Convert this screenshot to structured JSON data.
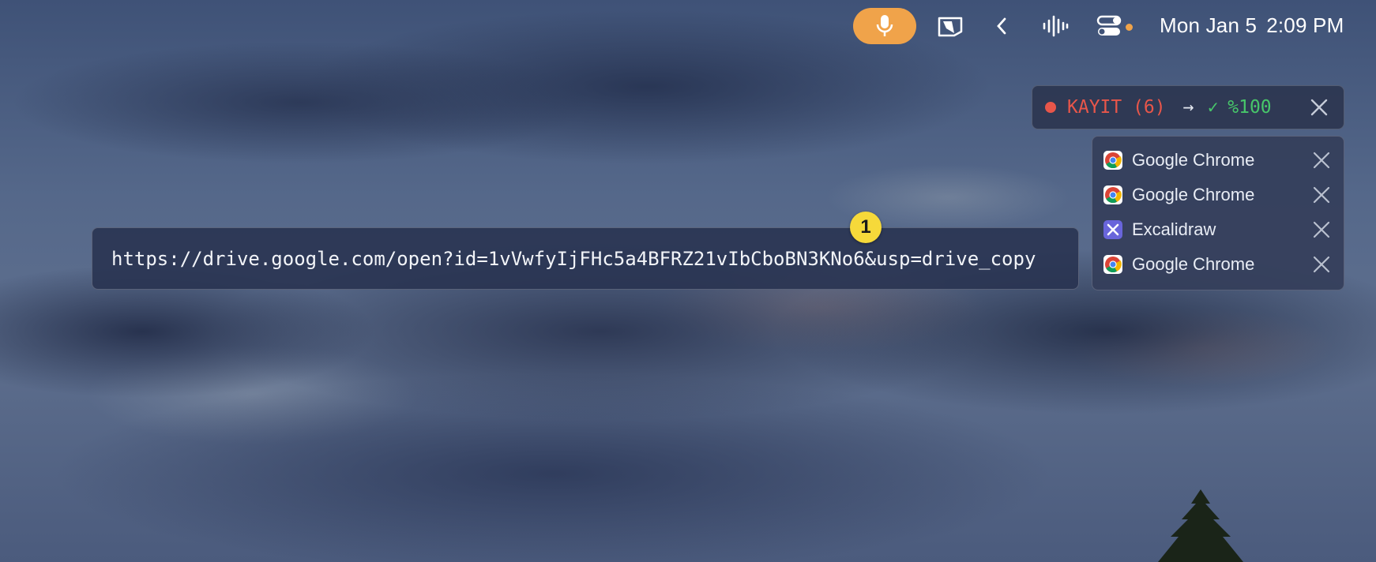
{
  "menubar": {
    "mic_icon": "microphone-icon",
    "stage_icon": "stage-manager-icon",
    "collapse_icon": "chevron-left-icon",
    "audio_icon": "audio-waveform-icon",
    "control_icon": "control-center-icon",
    "date": "Mon Jan 5",
    "time": "2:09 PM",
    "colors": {
      "mic_pill": "#f0a34a",
      "status_dot": "#f0a34a"
    }
  },
  "recording": {
    "label": "KAYIT (6)",
    "arrow": "→",
    "check": "✓",
    "percent": "%100",
    "colors": {
      "label": "#e8564a",
      "percent": "#47c66a"
    }
  },
  "windows": [
    {
      "label": "Google Chrome",
      "icon": "chrome-icon"
    },
    {
      "label": "Google Chrome",
      "icon": "chrome-icon"
    },
    {
      "label": "Excalidraw",
      "icon": "excalidraw-icon"
    },
    {
      "label": "Google Chrome",
      "icon": "chrome-icon"
    }
  ],
  "url": {
    "value": "https://drive.google.com/open?id=1vVwfyIjFHc5a4BFRZ21vIbCboBN3KNo6&usp=drive_copy"
  },
  "badge": {
    "number": "1",
    "color": "#f6d93a"
  }
}
